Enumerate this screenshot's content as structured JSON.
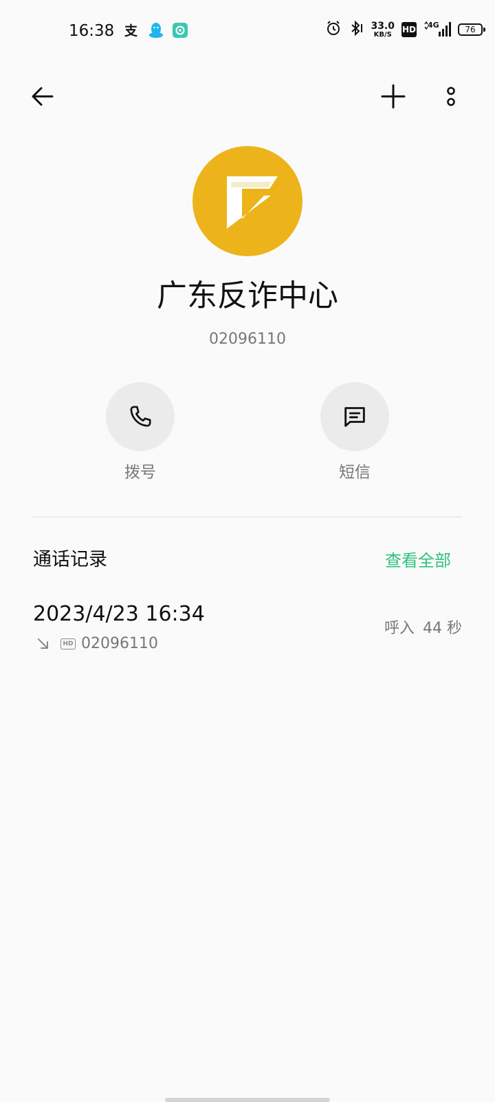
{
  "status_bar": {
    "time": "16:38",
    "left_icons": [
      "alipay-icon",
      "qq-icon",
      "app-icon"
    ],
    "net_speed_value": "33.0",
    "net_speed_unit": "KB/S",
    "hd_label": "HD",
    "network_label": "4G",
    "battery_level": "76"
  },
  "toolbar": {
    "back_icon": "arrow-left-icon",
    "add_icon": "plus-icon",
    "more_icon": "more-vertical-icon"
  },
  "contact": {
    "name": "广东反诈中心",
    "number": "02096110",
    "avatar_color": "#ecb41a"
  },
  "actions": {
    "dial_label": "拨号",
    "sms_label": "短信"
  },
  "call_log": {
    "title": "通话记录",
    "view_all": "查看全部",
    "accent_color": "#2fc27a",
    "records": [
      {
        "datetime": "2023/4/23 16:34",
        "hd": "HD",
        "number": "02096110",
        "type": "呼入",
        "duration": "44 秒"
      }
    ]
  }
}
